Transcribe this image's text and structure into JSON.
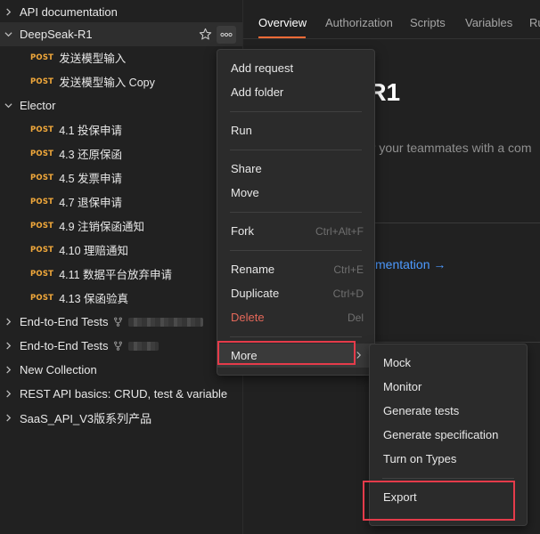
{
  "sidebar": {
    "rows": [
      {
        "label": "API documentation"
      },
      {
        "label": "DeepSeak-R1"
      },
      {
        "method": "POST",
        "label": "发送模型输入"
      },
      {
        "method": "POST",
        "label": "发送模型输入 Copy"
      },
      {
        "label": "Elector"
      },
      {
        "method": "POST",
        "label": "4.1 投保申请"
      },
      {
        "method": "POST",
        "label": "4.3 还原保函"
      },
      {
        "method": "POST",
        "label": "4.5 发票申请"
      },
      {
        "method": "POST",
        "label": "4.7 退保申请"
      },
      {
        "method": "POST",
        "label": "4.9 注销保函通知"
      },
      {
        "method": "POST",
        "label": "4.10 理赔通知"
      },
      {
        "method": "POST",
        "label": "4.11 数据平台放弃申请"
      },
      {
        "method": "POST",
        "label": "4.13 保函验真"
      },
      {
        "label": "End-to-End Tests"
      },
      {
        "label": "End-to-End Tests"
      },
      {
        "label": "New Collection"
      },
      {
        "label": "REST API basics: CRUD, test & variable"
      },
      {
        "label": "SaaS_API_V3版系列产品"
      }
    ]
  },
  "main": {
    "tabs": [
      {
        "label": "Overview"
      },
      {
        "label": "Authorization"
      },
      {
        "label": "Scripts"
      },
      {
        "label": "Variables"
      },
      {
        "label": "Ru"
      }
    ],
    "title": "-R1",
    "description": "or your teammates with a com",
    "doc_link": "mentation →"
  },
  "context_menu": {
    "items": [
      {
        "label": "Add request"
      },
      {
        "label": "Add folder"
      },
      {
        "label": "Run"
      },
      {
        "label": "Share"
      },
      {
        "label": "Move"
      },
      {
        "label": "Fork",
        "shortcut": "Ctrl+Alt+F"
      },
      {
        "label": "Rename",
        "shortcut": "Ctrl+E"
      },
      {
        "label": "Duplicate",
        "shortcut": "Ctrl+D"
      },
      {
        "label": "Delete",
        "shortcut": "Del"
      },
      {
        "label": "More"
      }
    ]
  },
  "submenu": {
    "items": [
      {
        "label": "Mock"
      },
      {
        "label": "Monitor"
      },
      {
        "label": "Generate tests"
      },
      {
        "label": "Generate specification"
      },
      {
        "label": "Turn on Types"
      },
      {
        "label": "Export"
      }
    ]
  },
  "colors": {
    "background": "#212121",
    "accent": "#ff6c37",
    "method_post": "#f2a93b",
    "link": "#4d9aff",
    "danger": "#e4685a",
    "highlight_box": "#e53b4a"
  }
}
